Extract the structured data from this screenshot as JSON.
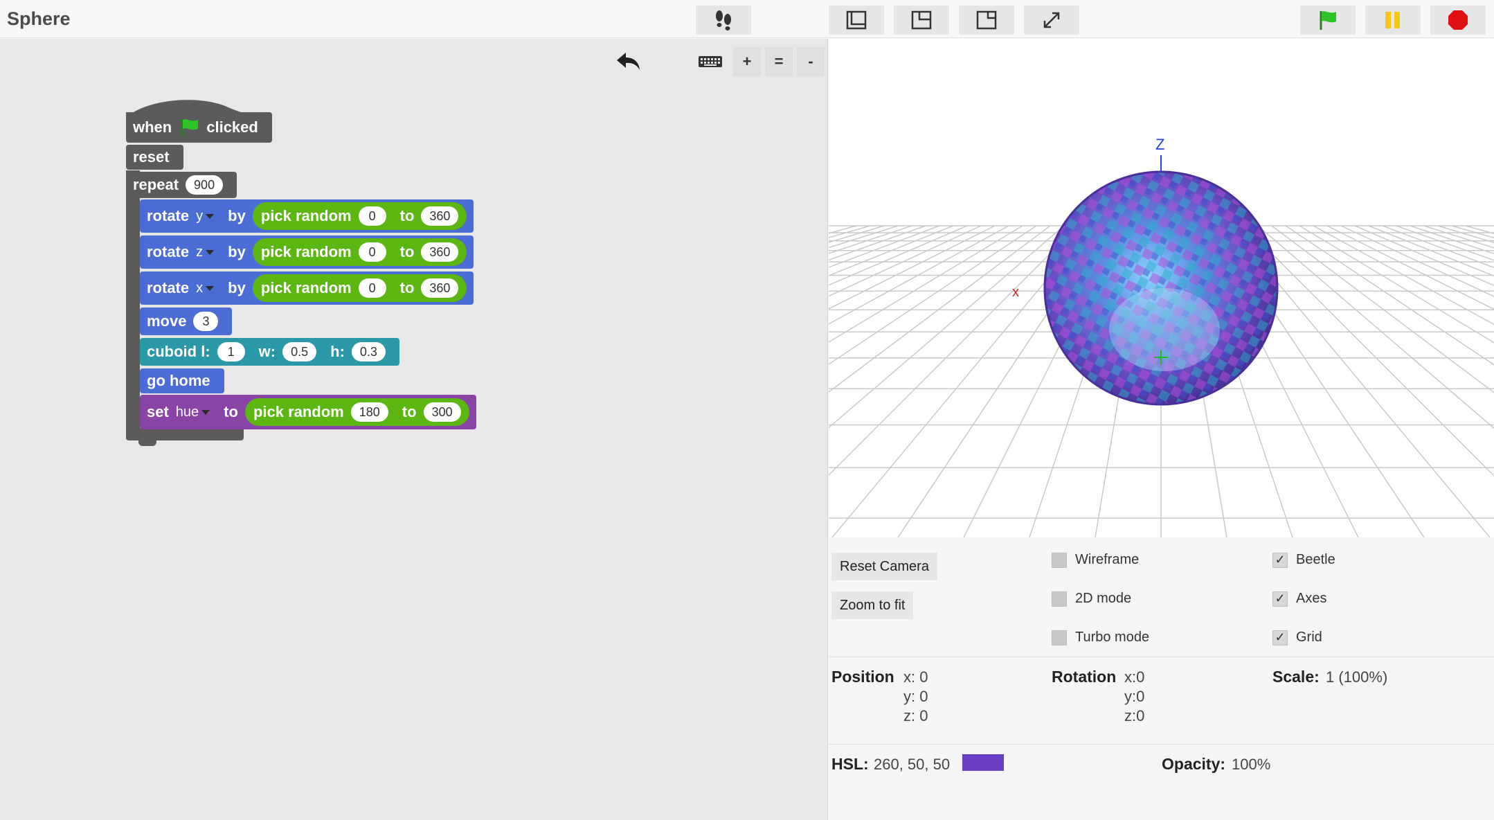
{
  "app": {
    "title": "Sphere"
  },
  "toolbar": {
    "icons": [
      "footsteps-icon",
      "layout-left-icon",
      "layout-center-icon",
      "layout-right-icon",
      "fullscreen-icon",
      "green-flag-icon",
      "pause-icon",
      "stop-icon"
    ],
    "colors": {
      "flag": "#2ec425",
      "pause": "#f5c518",
      "stop": "#e01010"
    }
  },
  "script_toolbar": {
    "zoom_in": "+",
    "zoom_reset": "=",
    "zoom_out": "-"
  },
  "script": {
    "hat_when": "when",
    "hat_clicked": "clicked",
    "reset": "reset",
    "repeat": "repeat",
    "repeat_count": "900",
    "rotate_y": {
      "verb": "rotate",
      "axis": "y",
      "by": "by",
      "pick": "pick random",
      "from": "0",
      "to": "to",
      "max": "360"
    },
    "rotate_z": {
      "verb": "rotate",
      "axis": "z",
      "by": "by",
      "pick": "pick random",
      "from": "0",
      "to": "to",
      "max": "360"
    },
    "rotate_x": {
      "verb": "rotate",
      "axis": "x",
      "by": "by",
      "pick": "pick random",
      "from": "0",
      "to": "to",
      "max": "360"
    },
    "move": {
      "verb": "move",
      "value": "3"
    },
    "cuboid": {
      "verb": "cuboid l:",
      "l": "1",
      "w_label": "w:",
      "w": "0.5",
      "h_label": "h:",
      "h": "0.3"
    },
    "go_home": "go home",
    "set_hue": {
      "verb": "set",
      "param": "hue",
      "to": "to",
      "pick": "pick random",
      "from": "180",
      "to2": "to",
      "max": "300"
    }
  },
  "viewport": {
    "axis_z": "Z",
    "axis_x": "x",
    "sphere_color": "#6a4bc4"
  },
  "controls": {
    "reset_camera": "Reset Camera",
    "zoom_to_fit": "Zoom to fit",
    "wireframe": "Wireframe",
    "mode_2d": "2D mode",
    "turbo_mode": "Turbo mode",
    "beetle": "Beetle",
    "axes": "Axes",
    "grid": "Grid",
    "check_glyph": "✓"
  },
  "info": {
    "position_label": "Position",
    "position_x": "x: 0",
    "position_y": "y: 0",
    "position_z": "z: 0",
    "rotation_label": "Rotation",
    "rotation_x": "x:0",
    "rotation_y": "y:0",
    "rotation_z": "z:0",
    "scale_label": "Scale:",
    "scale_value": "1 (100%)",
    "hsl_label": "HSL:",
    "hsl_value": "260, 50, 50",
    "hsl_swatch": "#6a3fc6",
    "opacity_label": "Opacity:",
    "opacity_value": "100%"
  }
}
